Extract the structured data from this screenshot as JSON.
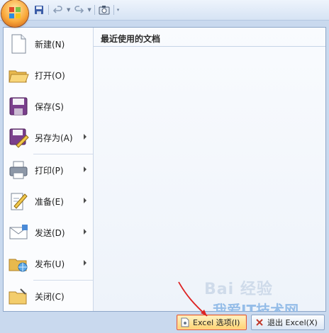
{
  "menu": {
    "items": [
      {
        "label": "新建(N)",
        "icon": "new-document-icon",
        "submenu": false
      },
      {
        "label": "打开(O)",
        "icon": "open-folder-icon",
        "submenu": false
      },
      {
        "label": "保存(S)",
        "icon": "save-disk-icon",
        "submenu": false
      },
      {
        "label": "另存为(A)",
        "icon": "save-as-icon",
        "submenu": true
      },
      {
        "label": "打印(P)",
        "icon": "printer-icon",
        "submenu": true
      },
      {
        "label": "准备(E)",
        "icon": "prepare-pencil-icon",
        "submenu": true
      },
      {
        "label": "发送(D)",
        "icon": "send-envelope-icon",
        "submenu": true
      },
      {
        "label": "发布(U)",
        "icon": "publish-folder-icon",
        "submenu": true
      },
      {
        "label": "关闭(C)",
        "icon": "close-folder-icon",
        "submenu": false
      }
    ]
  },
  "recent": {
    "title": "最近使用的文档"
  },
  "footer": {
    "options_label": "Excel 选项(I)",
    "exit_label": "退出 Excel(X)"
  },
  "watermark": {
    "line1": "Bai 经验",
    "line2": "我爱IT技术网"
  },
  "colors": {
    "accent": "#f9a93b",
    "highlight_border": "#e05a3a",
    "menu_border": "#8ea7c9"
  }
}
